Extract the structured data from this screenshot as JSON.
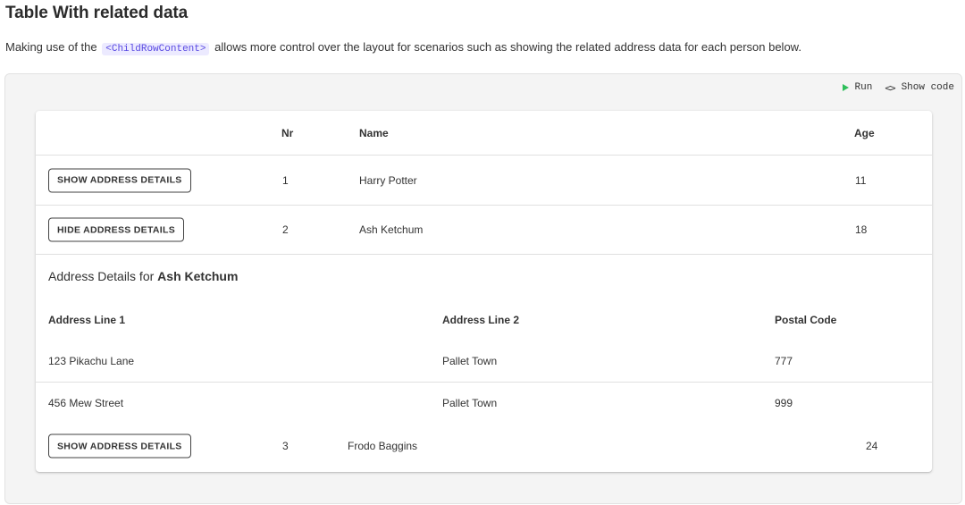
{
  "heading": "Table With related data",
  "intro": {
    "before": "Making use of the",
    "code": "<ChildRowContent>",
    "after": "allows more control over the layout for scenarios such as showing the related address data for each person below."
  },
  "toolbar": {
    "run_label": "Run",
    "show_code_label": "Show code",
    "run_icon": "play-icon",
    "code_icon": "code-icon",
    "code_glyph": "<>",
    "accent": "#2ebf5a"
  },
  "table": {
    "headers": {
      "nr": "Nr",
      "name": "Name",
      "age": "Age"
    },
    "rows": [
      {
        "button": "SHOW ADDRESS DETAILS",
        "nr": "1",
        "name": "Harry Potter",
        "age": "11"
      },
      {
        "button": "HIDE ADDRESS DETAILS",
        "nr": "2",
        "name": "Ash Ketchum",
        "age": "18"
      },
      {
        "button": "SHOW ADDRESS DETAILS",
        "nr": "3",
        "name": "Frodo Baggins",
        "age": "24"
      }
    ],
    "child": {
      "title_prefix": "Address Details for",
      "person": "Ash Ketchum",
      "headers": {
        "line1": "Address Line 1",
        "line2": "Address Line 2",
        "postal": "Postal Code"
      },
      "rows": [
        {
          "line1": "123 Pikachu Lane",
          "line2": "Pallet Town",
          "postal": "777"
        },
        {
          "line1": "456 Mew Street",
          "line2": "Pallet Town",
          "postal": "999"
        }
      ]
    }
  }
}
